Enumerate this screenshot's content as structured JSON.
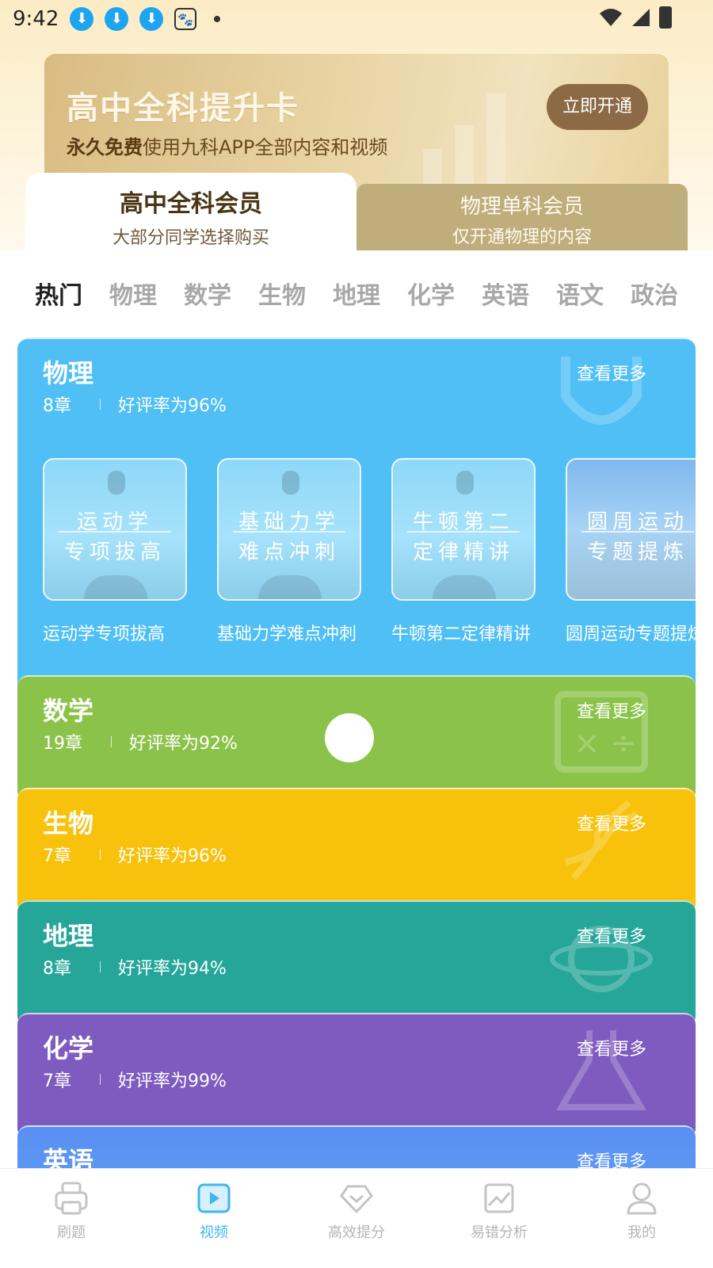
{
  "status_bar": {
    "time": "9:42",
    "icons": [
      "download-icon",
      "download-icon",
      "download-icon",
      "paw-icon",
      "dot-icon"
    ],
    "right_icons": [
      "wifi-icon",
      "signal-icon",
      "battery-icon"
    ]
  },
  "promo": {
    "title": "高中全科提升卡",
    "sub_bold": "永久免费",
    "sub_rest": "使用九科APP全部内容和视频",
    "button": "立即开通"
  },
  "membership_tabs": {
    "all": {
      "title": "高中全科会员",
      "subtitle": "大部分同学选择购买"
    },
    "single": {
      "title": "物理单科会员",
      "subtitle": "仅开通物理的内容"
    }
  },
  "subject_tabs": [
    "热门",
    "物理",
    "数学",
    "生物",
    "地理",
    "化学",
    "英语",
    "语文",
    "政治"
  ],
  "more_label": "查看更多",
  "cards": [
    {
      "name": "物理",
      "chapters": "8章",
      "rating": "好评率为96%",
      "color": "#4fbff5",
      "courses": [
        {
          "line1": "运动学",
          "line2": "专项拔高",
          "label": "运动学专项拔高"
        },
        {
          "line1": "基础力学",
          "line2": "难点冲刺",
          "label": "基础力学难点冲刺"
        },
        {
          "line1": "牛顿第二",
          "line2": "定律精讲",
          "label": "牛顿第二定律精讲"
        },
        {
          "line1": "圆周运动",
          "line2": "专题提炼",
          "label": "圆周运动专题提炼"
        }
      ]
    },
    {
      "name": "数学",
      "chapters": "19章",
      "rating": "好评率为92%",
      "color": "#8bc34a"
    },
    {
      "name": "生物",
      "chapters": "7章",
      "rating": "好评率为96%",
      "color": "#f8c20c"
    },
    {
      "name": "地理",
      "chapters": "8章",
      "rating": "好评率为94%",
      "color": "#26a699"
    },
    {
      "name": "化学",
      "chapters": "7章",
      "rating": "好评率为99%",
      "color": "#7e5bbf"
    },
    {
      "name": "英语",
      "color": "#4f8af0"
    }
  ],
  "bottom_nav": [
    {
      "label": "刷题",
      "icon": "printer-icon"
    },
    {
      "label": "视频",
      "icon": "video-icon",
      "active": true
    },
    {
      "label": "高效提分",
      "icon": "diamond-heart-icon"
    },
    {
      "label": "易错分析",
      "icon": "chart-image-icon"
    },
    {
      "label": "我的",
      "icon": "user-icon"
    }
  ],
  "colors": {
    "accent": "#3fb6ee",
    "gold": "#8c6a45",
    "tab_underline": "#f6c55a"
  }
}
